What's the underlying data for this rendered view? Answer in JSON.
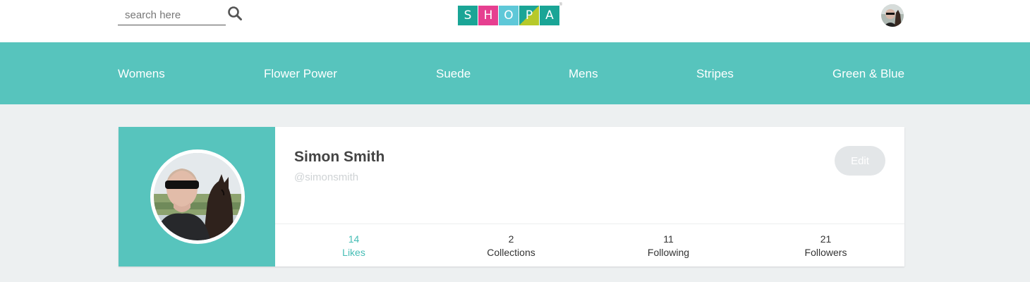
{
  "header": {
    "search": {
      "placeholder": "search here",
      "value": ""
    },
    "search_icon": "search-icon",
    "logo": {
      "letters": [
        "S",
        "H",
        "O",
        "P",
        "A"
      ],
      "colors": [
        "#1aa596",
        "#e63f90",
        "#5ec8d8",
        "#b6c92a",
        "#1aa596"
      ],
      "mark": "®"
    },
    "avatar": "user-avatar"
  },
  "nav": {
    "items": [
      {
        "label": "Womens"
      },
      {
        "label": "Flower Power"
      },
      {
        "label": "Suede"
      },
      {
        "label": "Mens"
      },
      {
        "label": "Stripes"
      },
      {
        "label": "Green & Blue"
      }
    ]
  },
  "profile": {
    "name": "Simon Smith",
    "handle": "@simonsmith",
    "edit_label": "Edit",
    "stats": [
      {
        "value": "14",
        "label": "Likes",
        "active": true
      },
      {
        "value": "2",
        "label": "Collections",
        "active": false
      },
      {
        "value": "11",
        "label": "Following",
        "active": false
      },
      {
        "value": "21",
        "label": "Followers",
        "active": false
      }
    ]
  },
  "colors": {
    "accent": "#57c4bd",
    "active_stat": "#45bdb5",
    "background": "#edf0f1"
  }
}
